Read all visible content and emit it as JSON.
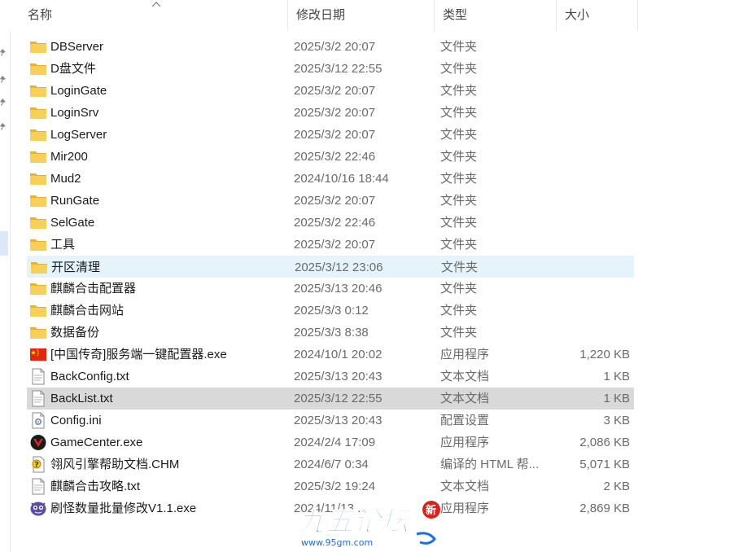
{
  "header": {
    "col_name": "名称",
    "col_date": "修改日期",
    "col_type": "类型",
    "col_size": "大小"
  },
  "files": [
    {
      "name": "DBServer",
      "date": "2025/3/2 20:07",
      "type": "文件夹",
      "size": "",
      "icon": "folder-icon"
    },
    {
      "name": "D盘文件",
      "date": "2025/3/12 22:55",
      "type": "文件夹",
      "size": "",
      "icon": "folder-icon"
    },
    {
      "name": "LoginGate",
      "date": "2025/3/2 20:07",
      "type": "文件夹",
      "size": "",
      "icon": "folder-icon"
    },
    {
      "name": "LoginSrv",
      "date": "2025/3/2 20:07",
      "type": "文件夹",
      "size": "",
      "icon": "folder-icon"
    },
    {
      "name": "LogServer",
      "date": "2025/3/2 20:07",
      "type": "文件夹",
      "size": "",
      "icon": "folder-icon"
    },
    {
      "name": "Mir200",
      "date": "2025/3/2 22:46",
      "type": "文件夹",
      "size": "",
      "icon": "folder-icon"
    },
    {
      "name": "Mud2",
      "date": "2024/10/16 18:44",
      "type": "文件夹",
      "size": "",
      "icon": "folder-icon"
    },
    {
      "name": "RunGate",
      "date": "2025/3/2 20:07",
      "type": "文件夹",
      "size": "",
      "icon": "folder-icon"
    },
    {
      "name": "SelGate",
      "date": "2025/3/2 22:46",
      "type": "文件夹",
      "size": "",
      "icon": "folder-icon"
    },
    {
      "name": "工具",
      "date": "2025/3/2 20:07",
      "type": "文件夹",
      "size": "",
      "icon": "folder-icon"
    },
    {
      "name": "开区清理",
      "date": "2025/3/12 23:06",
      "type": "文件夹",
      "size": "",
      "icon": "folder-icon"
    },
    {
      "name": "麒麟合击配置器",
      "date": "2025/3/13 20:46",
      "type": "文件夹",
      "size": "",
      "icon": "folder-icon"
    },
    {
      "name": "麒麟合击网站",
      "date": "2025/3/3 0:12",
      "type": "文件夹",
      "size": "",
      "icon": "folder-icon"
    },
    {
      "name": "数据备份",
      "date": "2025/3/3 8:38",
      "type": "文件夹",
      "size": "",
      "icon": "folder-icon"
    },
    {
      "name": "[中国传奇]服务端一键配置器.exe",
      "date": "2024/10/1 20:02",
      "type": "应用程序",
      "size": "1,220 KB",
      "icon": "china-flag-icon"
    },
    {
      "name": "BackConfig.txt",
      "date": "2025/3/13 20:43",
      "type": "文本文档",
      "size": "1 KB",
      "icon": "text-file-icon"
    },
    {
      "name": "BackList.txt",
      "date": "2025/3/12 22:55",
      "type": "文本文档",
      "size": "1 KB",
      "icon": "text-file-icon"
    },
    {
      "name": "Config.ini",
      "date": "2025/3/13 20:43",
      "type": "配置设置",
      "size": "3 KB",
      "icon": "settings-file-icon"
    },
    {
      "name": "GameCenter.exe",
      "date": "2024/2/4 17:09",
      "type": "应用程序",
      "size": "2,086 KB",
      "icon": "game-logo-icon"
    },
    {
      "name": "翎风引擎帮助文档.CHM",
      "date": "2024/6/7 0:34",
      "type": "编译的 HTML 帮...",
      "size": "5,071 KB",
      "icon": "help-file-icon"
    },
    {
      "name": "麒麟合击攻略.txt",
      "date": "2025/3/2 19:24",
      "type": "文本文档",
      "size": "2 KB",
      "icon": "text-file-icon"
    },
    {
      "name": "刷怪数量批量修改V1.1.exe",
      "date": "2024/11/13 ...",
      "type": "应用程序",
      "size": "2,869 KB",
      "icon": "monster-app-icon"
    }
  ],
  "state": {
    "hover_row": 10,
    "selected_row": 16
  },
  "watermark": {
    "main_text": "九五论坛",
    "url_text": "www.95gm.com",
    "badge_text": "新"
  },
  "colors": {
    "folder": "#f2c14e",
    "hover": "#e5f3fb",
    "selected": "#d9d9d9",
    "watermark_blue": "#1e6fd9"
  }
}
